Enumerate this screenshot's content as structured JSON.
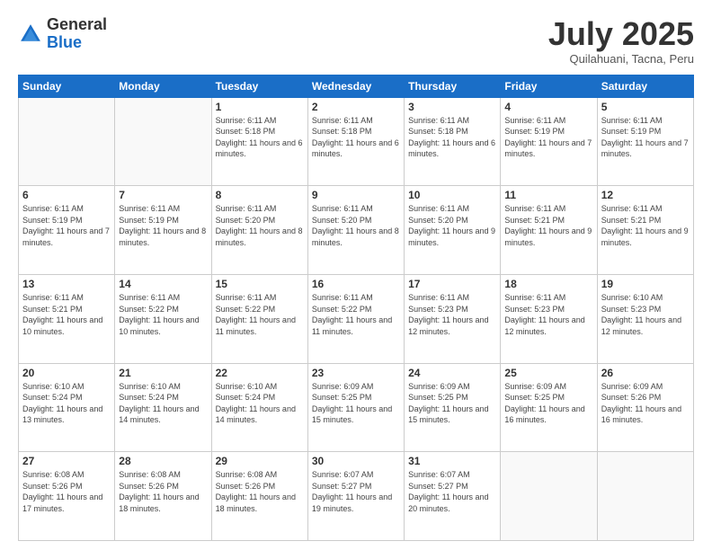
{
  "header": {
    "logo_general": "General",
    "logo_blue": "Blue",
    "month_title": "July 2025",
    "subtitle": "Quilahuani, Tacna, Peru"
  },
  "days_of_week": [
    "Sunday",
    "Monday",
    "Tuesday",
    "Wednesday",
    "Thursday",
    "Friday",
    "Saturday"
  ],
  "weeks": [
    [
      {
        "day": "",
        "info": ""
      },
      {
        "day": "",
        "info": ""
      },
      {
        "day": "1",
        "info": "Sunrise: 6:11 AM\nSunset: 5:18 PM\nDaylight: 11 hours and 6 minutes."
      },
      {
        "day": "2",
        "info": "Sunrise: 6:11 AM\nSunset: 5:18 PM\nDaylight: 11 hours and 6 minutes."
      },
      {
        "day": "3",
        "info": "Sunrise: 6:11 AM\nSunset: 5:18 PM\nDaylight: 11 hours and 6 minutes."
      },
      {
        "day": "4",
        "info": "Sunrise: 6:11 AM\nSunset: 5:19 PM\nDaylight: 11 hours and 7 minutes."
      },
      {
        "day": "5",
        "info": "Sunrise: 6:11 AM\nSunset: 5:19 PM\nDaylight: 11 hours and 7 minutes."
      }
    ],
    [
      {
        "day": "6",
        "info": "Sunrise: 6:11 AM\nSunset: 5:19 PM\nDaylight: 11 hours and 7 minutes."
      },
      {
        "day": "7",
        "info": "Sunrise: 6:11 AM\nSunset: 5:19 PM\nDaylight: 11 hours and 8 minutes."
      },
      {
        "day": "8",
        "info": "Sunrise: 6:11 AM\nSunset: 5:20 PM\nDaylight: 11 hours and 8 minutes."
      },
      {
        "day": "9",
        "info": "Sunrise: 6:11 AM\nSunset: 5:20 PM\nDaylight: 11 hours and 8 minutes."
      },
      {
        "day": "10",
        "info": "Sunrise: 6:11 AM\nSunset: 5:20 PM\nDaylight: 11 hours and 9 minutes."
      },
      {
        "day": "11",
        "info": "Sunrise: 6:11 AM\nSunset: 5:21 PM\nDaylight: 11 hours and 9 minutes."
      },
      {
        "day": "12",
        "info": "Sunrise: 6:11 AM\nSunset: 5:21 PM\nDaylight: 11 hours and 9 minutes."
      }
    ],
    [
      {
        "day": "13",
        "info": "Sunrise: 6:11 AM\nSunset: 5:21 PM\nDaylight: 11 hours and 10 minutes."
      },
      {
        "day": "14",
        "info": "Sunrise: 6:11 AM\nSunset: 5:22 PM\nDaylight: 11 hours and 10 minutes."
      },
      {
        "day": "15",
        "info": "Sunrise: 6:11 AM\nSunset: 5:22 PM\nDaylight: 11 hours and 11 minutes."
      },
      {
        "day": "16",
        "info": "Sunrise: 6:11 AM\nSunset: 5:22 PM\nDaylight: 11 hours and 11 minutes."
      },
      {
        "day": "17",
        "info": "Sunrise: 6:11 AM\nSunset: 5:23 PM\nDaylight: 11 hours and 12 minutes."
      },
      {
        "day": "18",
        "info": "Sunrise: 6:11 AM\nSunset: 5:23 PM\nDaylight: 11 hours and 12 minutes."
      },
      {
        "day": "19",
        "info": "Sunrise: 6:10 AM\nSunset: 5:23 PM\nDaylight: 11 hours and 12 minutes."
      }
    ],
    [
      {
        "day": "20",
        "info": "Sunrise: 6:10 AM\nSunset: 5:24 PM\nDaylight: 11 hours and 13 minutes."
      },
      {
        "day": "21",
        "info": "Sunrise: 6:10 AM\nSunset: 5:24 PM\nDaylight: 11 hours and 14 minutes."
      },
      {
        "day": "22",
        "info": "Sunrise: 6:10 AM\nSunset: 5:24 PM\nDaylight: 11 hours and 14 minutes."
      },
      {
        "day": "23",
        "info": "Sunrise: 6:09 AM\nSunset: 5:25 PM\nDaylight: 11 hours and 15 minutes."
      },
      {
        "day": "24",
        "info": "Sunrise: 6:09 AM\nSunset: 5:25 PM\nDaylight: 11 hours and 15 minutes."
      },
      {
        "day": "25",
        "info": "Sunrise: 6:09 AM\nSunset: 5:25 PM\nDaylight: 11 hours and 16 minutes."
      },
      {
        "day": "26",
        "info": "Sunrise: 6:09 AM\nSunset: 5:26 PM\nDaylight: 11 hours and 16 minutes."
      }
    ],
    [
      {
        "day": "27",
        "info": "Sunrise: 6:08 AM\nSunset: 5:26 PM\nDaylight: 11 hours and 17 minutes."
      },
      {
        "day": "28",
        "info": "Sunrise: 6:08 AM\nSunset: 5:26 PM\nDaylight: 11 hours and 18 minutes."
      },
      {
        "day": "29",
        "info": "Sunrise: 6:08 AM\nSunset: 5:26 PM\nDaylight: 11 hours and 18 minutes."
      },
      {
        "day": "30",
        "info": "Sunrise: 6:07 AM\nSunset: 5:27 PM\nDaylight: 11 hours and 19 minutes."
      },
      {
        "day": "31",
        "info": "Sunrise: 6:07 AM\nSunset: 5:27 PM\nDaylight: 11 hours and 20 minutes."
      },
      {
        "day": "",
        "info": ""
      },
      {
        "day": "",
        "info": ""
      }
    ]
  ]
}
